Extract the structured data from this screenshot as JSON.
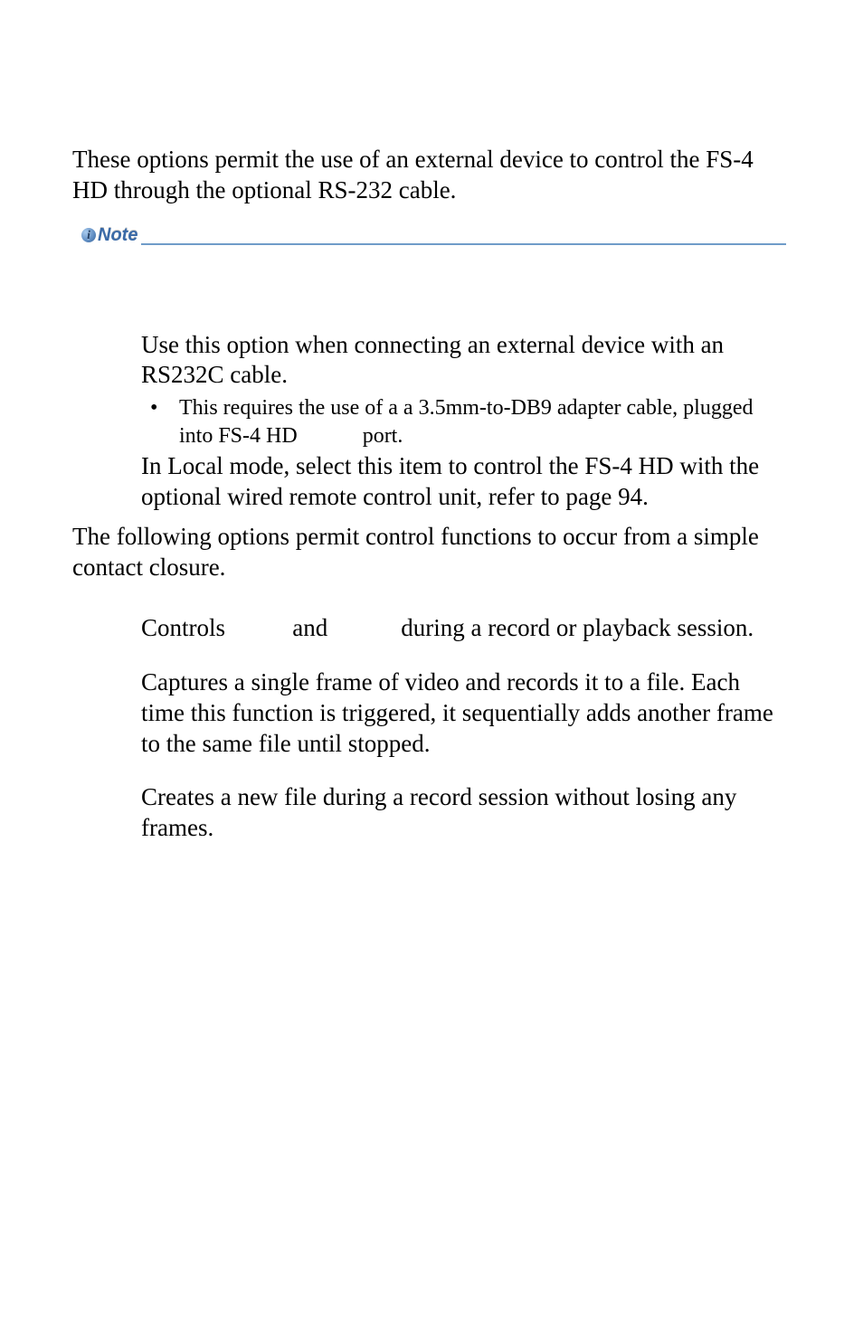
{
  "intro": "These options permit the use of an external device to control the FS-4 HD through the optional RS-232 cable.",
  "note": {
    "label": "Note"
  },
  "items": {
    "rs232c": {
      "para": "Use this option when connecting an external device with an RS232C cable.",
      "bullet_pre": "This requires the use of a a 3.5mm-to-DB9 adapter cable, plugged into FS-4 HD",
      "bullet_post": "port.",
      "local": "In Local mode, select this item to control the FS-4 HD with the optional wired remote control unit, refer to page 94."
    }
  },
  "midpara": "The following options permit control functions to occur from a simple contact closure.",
  "pause": {
    "pre": "Controls",
    "mid": "and",
    "post": "during a record or playback session."
  },
  "snap": "Captures a single frame of video and records it to a file. Each time this function is triggered, it sequentially adds another frame to the same file until stopped.",
  "newfile": "Creates a new file during a record session without losing any frames."
}
